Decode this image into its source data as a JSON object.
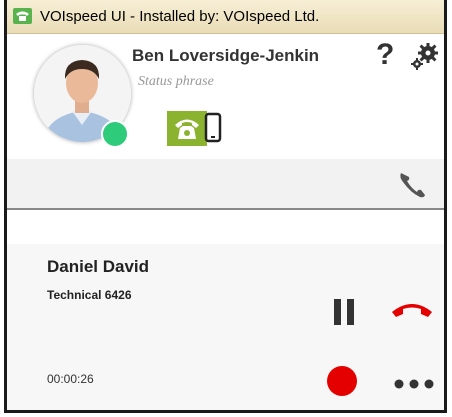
{
  "window": {
    "title": "VOIspeed UI - Installed by: VOIspeed Ltd."
  },
  "user": {
    "name": "Ben Loversidge-Jenkin",
    "status_phrase": "Status phrase",
    "presence_color": "#2ecc7a"
  },
  "header_actions": {
    "help_label": "?",
    "settings_icon": "gear-icon"
  },
  "modes": {
    "desk_phone_icon": "desk-phone-icon",
    "desk_phone_active_color": "#8bb32f",
    "mobile_icon": "mobile-phone-icon"
  },
  "call_bar": {
    "handset_icon": "handset-icon"
  },
  "call": {
    "caller_name": "Daniel David",
    "caller_detail": "Technical 6426",
    "duration": "00:00:26",
    "hangup_color": "#e50000",
    "record_color": "#e50000"
  }
}
